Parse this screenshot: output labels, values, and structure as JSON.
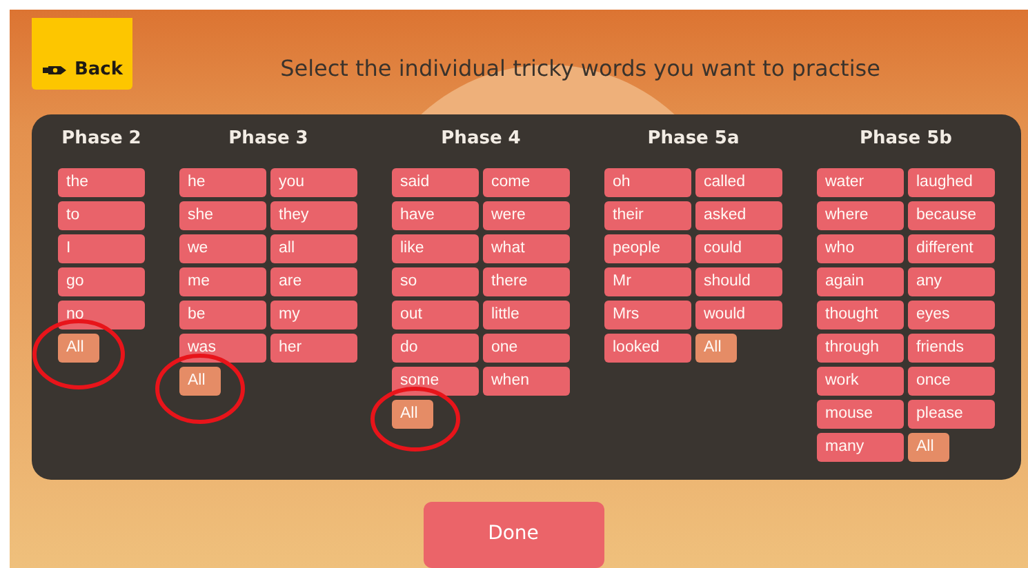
{
  "back_button": {
    "label": "Back"
  },
  "title": "Select the individual tricky words you want to practise",
  "phases": [
    {
      "heading": "Phase 2",
      "columns": [
        [
          {
            "label": "the",
            "kind": "word"
          },
          {
            "label": "to",
            "kind": "word"
          },
          {
            "label": "I",
            "kind": "word"
          },
          {
            "label": "go",
            "kind": "word"
          },
          {
            "label": "no",
            "kind": "word"
          },
          {
            "label": "All",
            "kind": "all"
          }
        ]
      ]
    },
    {
      "heading": "Phase 3",
      "columns": [
        [
          {
            "label": "he",
            "kind": "word"
          },
          {
            "label": "she",
            "kind": "word"
          },
          {
            "label": "we",
            "kind": "word"
          },
          {
            "label": "me",
            "kind": "word"
          },
          {
            "label": "be",
            "kind": "word"
          },
          {
            "label": "was",
            "kind": "word"
          },
          {
            "label": "All",
            "kind": "all"
          }
        ],
        [
          {
            "label": "you",
            "kind": "word"
          },
          {
            "label": "they",
            "kind": "word"
          },
          {
            "label": "all",
            "kind": "word"
          },
          {
            "label": "are",
            "kind": "word"
          },
          {
            "label": "my",
            "kind": "word"
          },
          {
            "label": "her",
            "kind": "word"
          }
        ]
      ]
    },
    {
      "heading": "Phase 4",
      "columns": [
        [
          {
            "label": "said",
            "kind": "word"
          },
          {
            "label": "have",
            "kind": "word"
          },
          {
            "label": "like",
            "kind": "word"
          },
          {
            "label": "so",
            "kind": "word"
          },
          {
            "label": "out",
            "kind": "word"
          },
          {
            "label": "do",
            "kind": "word"
          },
          {
            "label": "some",
            "kind": "word"
          },
          {
            "label": "All",
            "kind": "all"
          }
        ],
        [
          {
            "label": "come",
            "kind": "word"
          },
          {
            "label": "were",
            "kind": "word"
          },
          {
            "label": "what",
            "kind": "word"
          },
          {
            "label": "there",
            "kind": "word"
          },
          {
            "label": "little",
            "kind": "word"
          },
          {
            "label": "one",
            "kind": "word"
          },
          {
            "label": "when",
            "kind": "word"
          }
        ]
      ]
    },
    {
      "heading": "Phase 5a",
      "columns": [
        [
          {
            "label": "oh",
            "kind": "word"
          },
          {
            "label": "their",
            "kind": "word"
          },
          {
            "label": "people",
            "kind": "word"
          },
          {
            "label": "Mr",
            "kind": "word"
          },
          {
            "label": "Mrs",
            "kind": "word"
          },
          {
            "label": "looked",
            "kind": "word"
          }
        ],
        [
          {
            "label": "called",
            "kind": "word"
          },
          {
            "label": "asked",
            "kind": "word"
          },
          {
            "label": "could",
            "kind": "word"
          },
          {
            "label": "should",
            "kind": "word"
          },
          {
            "label": "would",
            "kind": "word"
          },
          {
            "label": "All",
            "kind": "all"
          }
        ]
      ]
    },
    {
      "heading": "Phase 5b",
      "columns": [
        [
          {
            "label": "water",
            "kind": "word"
          },
          {
            "label": "where",
            "kind": "word"
          },
          {
            "label": "who",
            "kind": "word"
          },
          {
            "label": "again",
            "kind": "word"
          },
          {
            "label": "thought",
            "kind": "word"
          },
          {
            "label": "through",
            "kind": "word"
          },
          {
            "label": "work",
            "kind": "word"
          },
          {
            "label": "mouse",
            "kind": "word"
          },
          {
            "label": "many",
            "kind": "word"
          }
        ],
        [
          {
            "label": "laughed",
            "kind": "word"
          },
          {
            "label": "because",
            "kind": "word"
          },
          {
            "label": "different",
            "kind": "word"
          },
          {
            "label": "any",
            "kind": "word"
          },
          {
            "label": "eyes",
            "kind": "word"
          },
          {
            "label": "friends",
            "kind": "word"
          },
          {
            "label": "once",
            "kind": "word"
          },
          {
            "label": "please",
            "kind": "word"
          },
          {
            "label": "All",
            "kind": "all"
          }
        ]
      ]
    }
  ],
  "done_button": {
    "label": "Done"
  }
}
